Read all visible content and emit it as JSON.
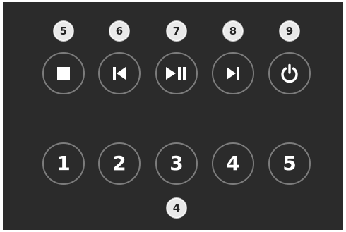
{
  "colors": {
    "panel_background": "#2b2b2b",
    "button_ring": "#7c7c7c",
    "glyph": "#ffffff",
    "callout_fill": "#e9e9e9",
    "callout_text": "#222222"
  },
  "transport": {
    "stop": {
      "icon": "stop-icon",
      "callout": "5"
    },
    "previous": {
      "icon": "skip-previous-icon",
      "callout": "6"
    },
    "play_pause": {
      "icon": "play-pause-icon",
      "callout": "7"
    },
    "next": {
      "icon": "skip-next-icon",
      "callout": "8"
    },
    "power": {
      "icon": "power-icon",
      "callout": "9"
    }
  },
  "presets": {
    "labels": [
      "1",
      "2",
      "3",
      "4",
      "5"
    ],
    "callout": "4"
  }
}
